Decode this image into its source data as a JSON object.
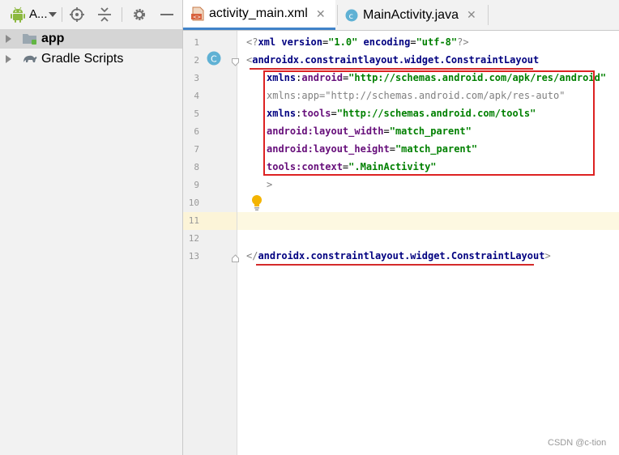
{
  "project_panel": {
    "title": "A...",
    "tree": [
      {
        "label": "app",
        "bold": true,
        "selected": true
      },
      {
        "label": "Gradle Scripts",
        "bold": false,
        "selected": false
      }
    ]
  },
  "tabs": [
    {
      "label": "activity_main.xml",
      "active": true,
      "icon": "xml-file-icon"
    },
    {
      "label": "MainActivity.java",
      "active": false,
      "icon": "java-class-icon"
    }
  ],
  "editor": {
    "line_numbers": [
      "1",
      "2",
      "3",
      "4",
      "5",
      "6",
      "7",
      "8",
      "9",
      "10",
      "11",
      "12",
      "13"
    ],
    "lines": {
      "l1": {
        "open": "<?",
        "kw": "xml version",
        "eq1": "=",
        "v1": "\"1.0\"",
        "sp": " ",
        "kw2": "encoding",
        "eq2": "=",
        "v2": "\"utf-8\"",
        "close": "?>"
      },
      "l2": {
        "open": "<",
        "tag": "androidx.constraintlayout.widget.ConstraintLayout"
      },
      "l3": {
        "ns": "xmlns",
        "colon": ":",
        "name": "android",
        "eq": "=",
        "val": "\"http://schemas.android.com/apk/res/android\""
      },
      "l4": {
        "text": "xmlns:app=\"http://schemas.android.com/apk/res-auto\""
      },
      "l5": {
        "ns": "xmlns",
        "colon": ":",
        "name": "tools",
        "eq": "=",
        "val": "\"http://schemas.android.com/tools\""
      },
      "l6": {
        "attr": "android:layout_width",
        "eq": "=",
        "val": "\"match_parent\""
      },
      "l7": {
        "attr": "android:layout_height",
        "eq": "=",
        "val": "\"match_parent\""
      },
      "l8": {
        "attr": "tools:context",
        "eq": "=",
        "val": "\".MainActivity\""
      },
      "l9": {
        "text": ">"
      },
      "l13": {
        "open": "</",
        "tag": "androidx.constraintlayout.widget.ConstraintLayout",
        "close": ">"
      }
    },
    "current_line": 11
  },
  "watermark": "CSDN @c-tion",
  "colors": {
    "tab_underline": "#4083c9",
    "annotation_red": "#dd2222",
    "xml_tag": "#000080",
    "xml_attr": "#660e7a",
    "xml_string": "#008000"
  }
}
